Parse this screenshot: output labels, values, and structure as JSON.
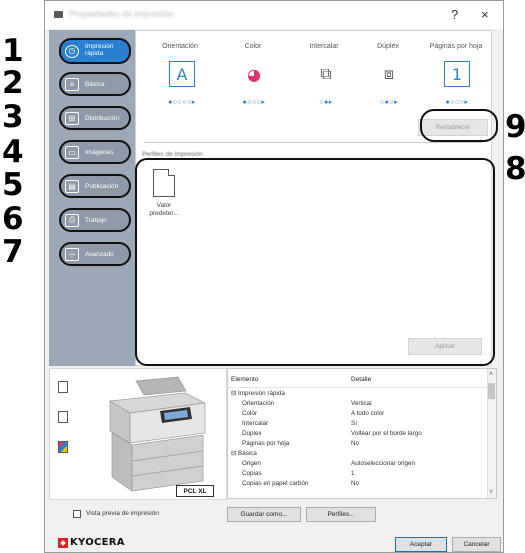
{
  "window": {
    "title": "Propiedades de impresión",
    "help_glyph": "?",
    "close_glyph": "×"
  },
  "callouts": [
    "1",
    "2",
    "3",
    "4",
    "5",
    "6",
    "7",
    "8",
    "9"
  ],
  "nav": {
    "items": [
      {
        "label": "Impresión rápida",
        "icon": "print-quick-icon",
        "glyph": "◷"
      },
      {
        "label": "Básica",
        "icon": "basic-icon",
        "glyph": "≡"
      },
      {
        "label": "Distribución",
        "icon": "layout-icon",
        "glyph": "⊞"
      },
      {
        "label": "Imágenes",
        "icon": "image-icon",
        "glyph": "▭"
      },
      {
        "label": "Publicación",
        "icon": "publishing-icon",
        "glyph": "▤"
      },
      {
        "label": "Trabajo",
        "icon": "job-icon",
        "glyph": "⎙"
      },
      {
        "label": "Avanzado",
        "icon": "advanced-icon",
        "glyph": "⊹"
      }
    ]
  },
  "quick": {
    "columns": [
      {
        "header": "Orientación",
        "glyph": "A",
        "dots": "●○○○○▸"
      },
      {
        "header": "Color",
        "glyph": "◕",
        "dots": "●○○○▸"
      },
      {
        "header": "Intercalar",
        "glyph": "⧉",
        "dots": "○●▸"
      },
      {
        "header": "Dúplex",
        "glyph": "⧈",
        "dots": "○●○▸"
      },
      {
        "header": "Páginas por hoja",
        "glyph": "1",
        "dots": "●○○○▸"
      }
    ],
    "reset_button": "Restablecer",
    "favorites_label": "Perfiles de impresión",
    "favorite_item": "Valor predeter...",
    "apply_button": "Aplicar"
  },
  "summary": {
    "col_item": "Elemento",
    "col_detail": "Detalle",
    "rows": [
      {
        "item": "⊟ Impresión rápida",
        "detail": "",
        "indent": 0
      },
      {
        "item": "Orientación",
        "detail": "Vertical",
        "indent": 1
      },
      {
        "item": "Color",
        "detail": "A todo color",
        "indent": 1
      },
      {
        "item": "Intercalar",
        "detail": "Sí",
        "indent": 1
      },
      {
        "item": "Dúplex",
        "detail": "Voltear por el borde largo",
        "indent": 1
      },
      {
        "item": "Páginas por hoja",
        "detail": "No",
        "indent": 1
      },
      {
        "item": "⊟ Básica",
        "detail": "",
        "indent": 0
      },
      {
        "item": "Origen",
        "detail": "Autoseleccionar origen",
        "indent": 1
      },
      {
        "item": "Copias",
        "detail": "1",
        "indent": 1
      },
      {
        "item": "Copias en papel carbón",
        "detail": "No",
        "indent": 1
      }
    ]
  },
  "printer": {
    "badge": "PCL XL"
  },
  "bottom": {
    "preview_checkbox": "Vista previa de impresión",
    "save_as_button": "Guardar como...",
    "profiles_button": "Perfiles...",
    "ok_button": "Aceptar",
    "cancel_button": "Cancelar",
    "logo_text": "KYOCERA"
  },
  "colors": {
    "accent": "#2b7fd0",
    "nav_bg": "#9da8b7",
    "logo_red": "#d9232b"
  }
}
